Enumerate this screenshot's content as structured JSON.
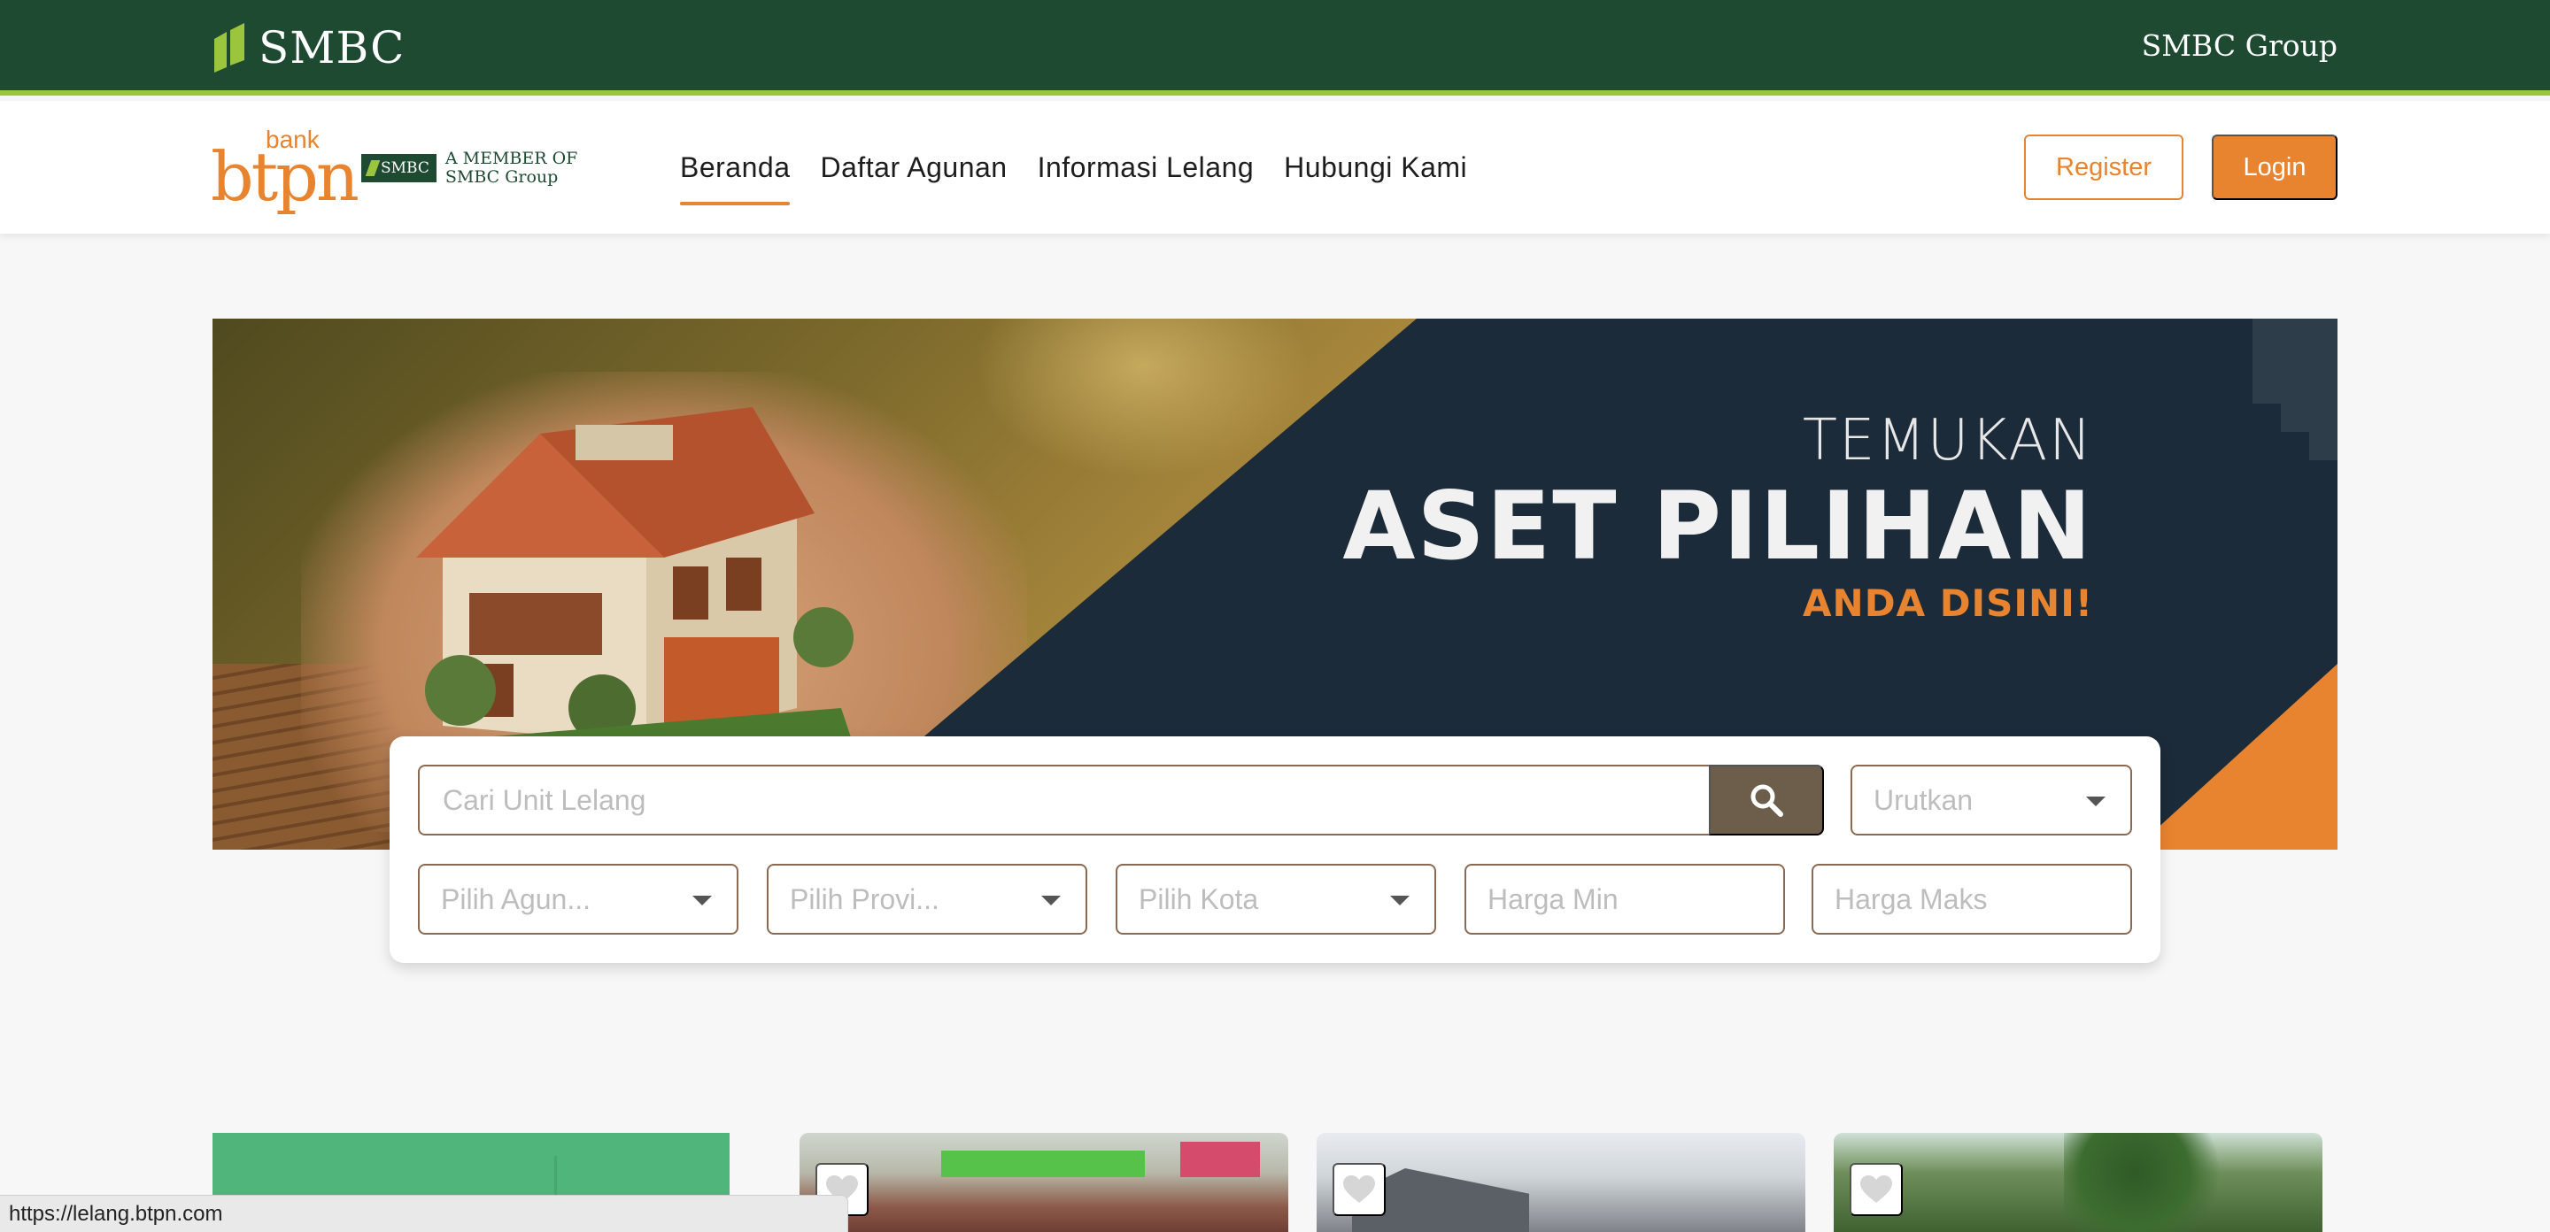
{
  "topbar": {
    "logo_text": "SMBC",
    "group_link": "SMBC Group"
  },
  "brand": {
    "bank_small": "bank",
    "bank_name": "btpn",
    "member_chip": "SMBC",
    "member_line1": "A MEMBER OF",
    "member_line2": "SMBC Group"
  },
  "nav": {
    "items": [
      {
        "label": "Beranda",
        "active": true
      },
      {
        "label": "Daftar Agunan",
        "active": false
      },
      {
        "label": "Informasi Lelang",
        "active": false
      },
      {
        "label": "Hubungi Kami",
        "active": false
      }
    ],
    "register_label": "Register",
    "login_label": "Login"
  },
  "hero": {
    "line1": "TEMUKAN",
    "line2": "ASET PILIHAN",
    "line3": "ANDA DISINI!"
  },
  "search": {
    "placeholder": "Cari Unit Lelang",
    "sort_placeholder": "Urutkan",
    "agunan_placeholder": "Pilih Agun...",
    "provinsi_placeholder": "Pilih Provi...",
    "kota_placeholder": "Pilih Kota",
    "harga_min_placeholder": "Harga Min",
    "harga_maks_placeholder": "Harga Maks"
  },
  "icons": {
    "search": "search-icon",
    "caret": "chevron-down-icon",
    "favorite": "heart-icon"
  },
  "colors": {
    "smbc_green": "#1e4a32",
    "accent_lime": "#9bc53d",
    "brand_orange": "#e8832f",
    "search_button": "#6d5d4b"
  },
  "status_bar": {
    "url": "https://lelang.btpn.com"
  }
}
